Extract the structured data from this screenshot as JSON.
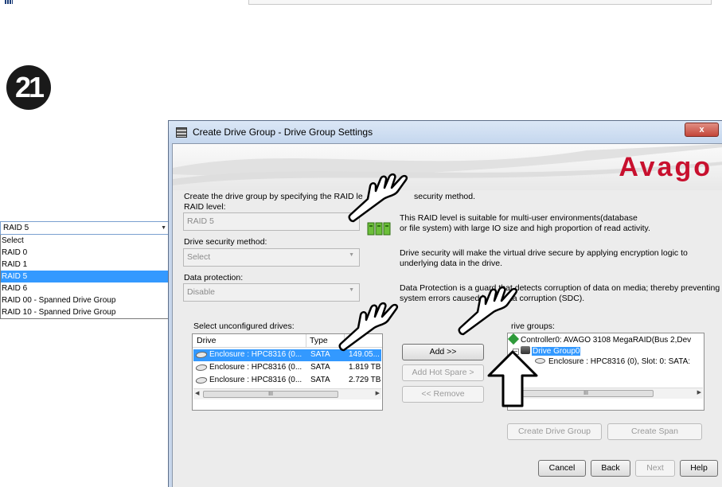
{
  "step": {
    "number": "21"
  },
  "raid_dropdown": {
    "selected": "RAID 5",
    "options": [
      "Select",
      "RAID 0",
      "RAID 1",
      "RAID 5",
      "RAID 6",
      "RAID 00 - Spanned Drive Group",
      "RAID 10 - Spanned Drive Group"
    ],
    "highlighted_index": 3
  },
  "dialog": {
    "title": "Create Drive Group - Drive Group Settings",
    "close_label": "x",
    "logo": "Avago",
    "intro_left": "Create the drive group by specifying the RAID le",
    "intro_right": "security method.",
    "raid_level_label": "RAID level:",
    "raid_level_value": "RAID 5",
    "raid_help": [
      "This RAID level is suitable for multi-user environments(database",
      "or file system) with large IO size and high proportion of read activity."
    ],
    "security_label": "Drive security method:",
    "security_value": "Select",
    "security_help": [
      "Drive security will make the virtual drive secure by applying encryption logic to",
      "underlying data in the drive."
    ],
    "protection_label": "Data protection:",
    "protection_value": "Disable",
    "protection_help_1a": "Data Protection is a guard that detects corruption of data on media; thereby preventing",
    "protection_help_2a": "system errors caused b",
    "protection_help_2b": "ata corruption (SDC).",
    "unconfigured_label": "Select unconfigured drives:",
    "columns": {
      "drive": "Drive",
      "type": "Type"
    },
    "drives": [
      {
        "drive": "Enclosure : HPC8316 (0...",
        "type": "SATA",
        "size": "149.05..."
      },
      {
        "drive": "Enclosure : HPC8316 (0...",
        "type": "SATA",
        "size": "1.819 TB"
      },
      {
        "drive": "Enclosure : HPC8316 (0...",
        "type": "SATA",
        "size": "2.729 TB"
      }
    ],
    "scroll_thumb": "III",
    "add_button": "Add >>",
    "hot_spare_button": "Add Hot Spare >",
    "remove_button": "<< Remove",
    "drive_groups_label": "rive groups:",
    "tree": {
      "controller": "Controller0: AVAGO 3108 MegaRAID(Bus 2,Dev",
      "group": "Drive Group0",
      "member": "Enclosure : HPC8316 (0), Slot: 0: SATA:"
    },
    "create_group_button": "Create Drive Group",
    "create_span_button": "Create Span",
    "cancel_button": "Cancel",
    "back_button": "Back",
    "next_button": "Next",
    "help_button": "Help"
  },
  "colors": {
    "selection": "#3399ff",
    "logo": "#c8102e",
    "title_bar": "#c7d6eb"
  }
}
